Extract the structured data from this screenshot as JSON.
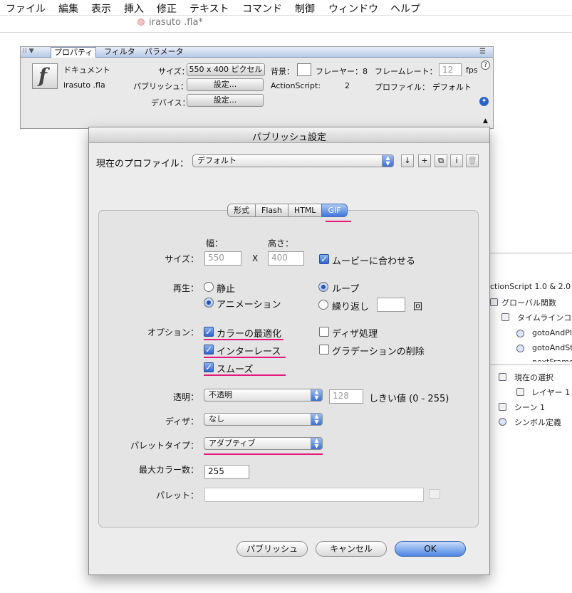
{
  "menubar": {
    "items": [
      "ファイル",
      "編集",
      "表示",
      "挿入",
      "修正",
      "テキスト",
      "コマンド",
      "制御",
      "ウィンドウ",
      "ヘルプ"
    ]
  },
  "document_tab": {
    "title": "irasuto .fla*"
  },
  "properties_panel": {
    "tabs": [
      "プロパティ",
      "フィルタ",
      "パラメータ"
    ],
    "doc_type": "ドキュメント",
    "file_name": "irasuto .fla",
    "size_label": "サイズ：",
    "size_value": "550 x 400 ピクセル",
    "background_label": "背景：",
    "player_label": "フレーヤー：8",
    "framerate_label": "フレームレート：",
    "framerate_value": "12",
    "fps_label": "fps",
    "publish_label": "パブリッシュ：",
    "publish_button": "設定...",
    "actionscript_label": "ActionScript:",
    "actionscript_value": "2",
    "profile_label": "プロファイル：",
    "profile_value": "デフォルト",
    "device_label": "デバイス：",
    "device_button": "設定..."
  },
  "timeline_panel": {
    "header": "ctionScript 1.0 & 2.0",
    "rows": [
      "グローバル関数",
      "タイムラインコ",
      "gotoAndPl",
      "gotoAndSt",
      "nextFrame",
      "現在の選択",
      "レイヤー 1",
      "シーン 1",
      "シンボル定義"
    ]
  },
  "dialog": {
    "title": "パブリッシュ設定",
    "profile_label": "現在のプロファイル：",
    "profile_value": "デフォルト",
    "tool_buttons": [
      "↓",
      "+",
      "⧉",
      "i",
      "🗑"
    ],
    "tabs": [
      "形式",
      "Flash",
      "HTML",
      "GIF"
    ],
    "active_tab": "GIF",
    "width_label": "幅：",
    "height_label": "高さ：",
    "size_label": "サイズ：",
    "width_value": "550",
    "x_label": "X",
    "height_value": "400",
    "match_movie_label": "ムービーに合わせる",
    "playback_label": "再生：",
    "static_label": "静止",
    "animation_label": "アニメーション",
    "loop_label": "ループ",
    "repeat_label": "繰り返し",
    "repeat_value": "",
    "times_label": "回",
    "options_label": "オプション：",
    "optimize_colors_label": "カラーの最適化",
    "interlace_label": "インターレース",
    "smooth_label": "スムーズ",
    "dither_solids_label": "ディザ処理",
    "remove_gradients_label": "グラデーションの削除",
    "transparent_label": "透明：",
    "transparent_value": "不透明",
    "threshold_value": "128",
    "threshold_label": "しきい値 (0 - 255)",
    "dither_label": "ディザ：",
    "dither_value": "なし",
    "palette_type_label": "パレットタイプ：",
    "palette_type_value": "アダプティブ",
    "max_colors_label": "最大カラー数：",
    "max_colors_value": "255",
    "palette_label": "パレット：",
    "palette_value": "",
    "publish_button": "パブリッシュ",
    "cancel_button": "キャンセル",
    "ok_button": "OK"
  },
  "colors": {
    "accent_underline": "#e6197a",
    "selection_blue": "#3f78de"
  }
}
